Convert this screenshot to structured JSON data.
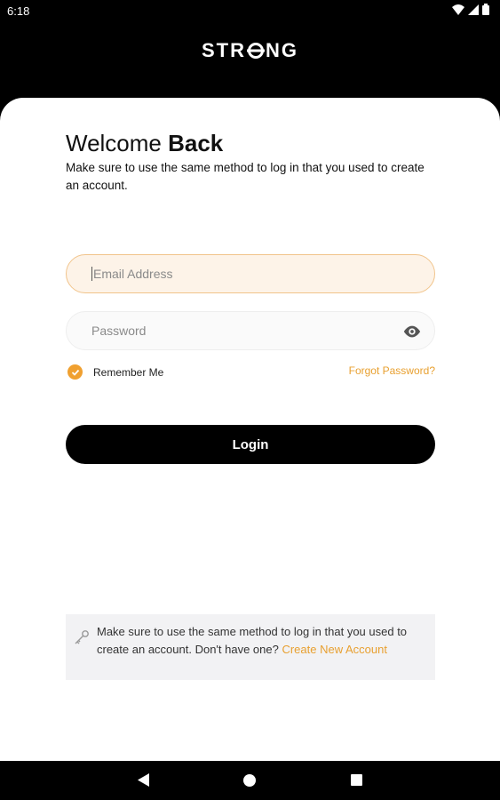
{
  "status_bar": {
    "time": "6:18"
  },
  "header": {
    "logo_text_1": "STR",
    "logo_text_2": "NG"
  },
  "login": {
    "title_regular": "Welcome ",
    "title_bold": "Back",
    "subtitle": "Make sure to use the same method to log in that you used to create an account.",
    "email_placeholder": "Email Address",
    "password_placeholder": "Password",
    "remember_label": "Remember Me",
    "forgot_label": "Forgot Password?",
    "login_label": "Login"
  },
  "info": {
    "text": "Make sure to use the same method to log in that you used to create an account. Don't have one? ",
    "link": "Create New Account"
  },
  "colors": {
    "accent": "#e8a030",
    "email_bg": "#fdf3e8",
    "button": "#000000"
  }
}
